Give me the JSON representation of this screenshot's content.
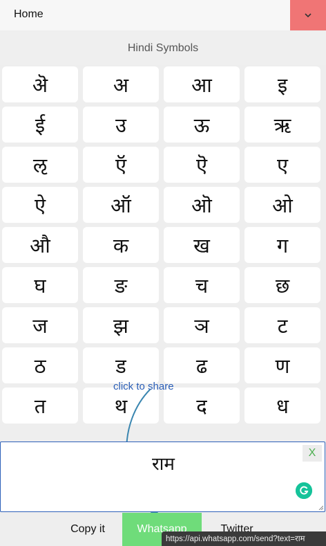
{
  "header": {
    "select_value": "Home"
  },
  "section": {
    "title": "Hindi Symbols"
  },
  "symbols": [
    "ऄ",
    "अ",
    "आ",
    "इ",
    "ई",
    "उ",
    "ऊ",
    "ऋ",
    "ऌ",
    "ऍ",
    "ऎ",
    "ए",
    "ऐ",
    "ऑ",
    "ऒ",
    "ओ",
    "औ",
    "क",
    "ख",
    "ग",
    "घ",
    "ङ",
    "च",
    "छ",
    "ज",
    "झ",
    "ञ",
    "ट",
    "ठ",
    "ड",
    "ढ",
    "ण",
    "त",
    "थ",
    "द",
    "ध"
  ],
  "hint": {
    "text": "click to share"
  },
  "output": {
    "value": "राम",
    "clear_label": "X"
  },
  "actions": {
    "copy": "Copy it",
    "whatsapp": "Whatsapp",
    "twitter": "Twitter"
  },
  "status": {
    "url": "https://api.whatsapp.com/send?text=राम"
  },
  "colors": {
    "dropdown": "#f07575",
    "whatsapp": "#6fdc7a",
    "accent_border": "#2c5fb8",
    "grammarly": "#15c39a"
  }
}
